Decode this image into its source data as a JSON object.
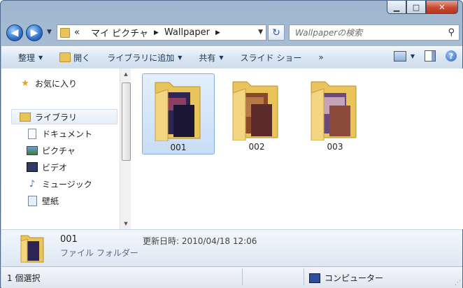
{
  "window": {
    "caption": {
      "minimize": "▁",
      "maximize": "□",
      "close": "✕"
    }
  },
  "nav": {
    "back": "◀",
    "forward": "▶",
    "breadcrumb": [
      "«",
      "マイ ピクチャ",
      "Wallpaper"
    ],
    "search_placeholder": "Wallpaperの検索"
  },
  "toolbar": {
    "organize": "整理",
    "open": "開く",
    "add_library": "ライブラリに追加",
    "share": "共有",
    "slideshow": "スライド ショー",
    "more": "»"
  },
  "sidebar": {
    "favorites": "お気に入り",
    "library": "ライブラリ",
    "items": [
      "ドキュメント",
      "ピクチャ",
      "ビデオ",
      "ミュージック",
      "壁紙"
    ]
  },
  "folders": [
    {
      "name": "001",
      "selected": true
    },
    {
      "name": "002",
      "selected": false
    },
    {
      "name": "003",
      "selected": false
    }
  ],
  "details": {
    "name": "001",
    "type": "ファイル フォルダー",
    "modified": "更新日時: 2010/04/18 12:06"
  },
  "status": {
    "count": "1 個選択",
    "location": "コンピューター"
  },
  "colors": {
    "accent": "#2f6fc6",
    "folder": "#f0d072",
    "selection": "#c7ddf6"
  }
}
